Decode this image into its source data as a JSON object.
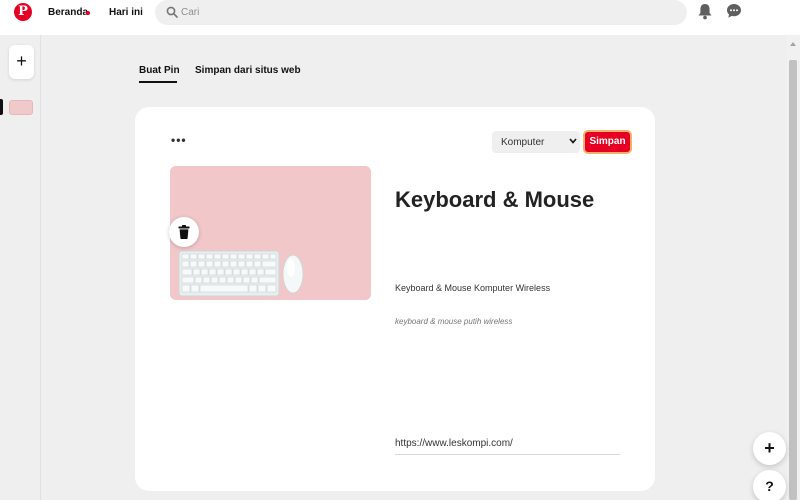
{
  "header": {
    "logo_letter": "P",
    "nav": [
      {
        "label": "Beranda"
      },
      {
        "label": "Hari ini"
      }
    ],
    "search": {
      "placeholder": "Cari"
    }
  },
  "rail": {
    "add_label": "+"
  },
  "tabs": [
    {
      "label": "Buat Pin",
      "active": true
    },
    {
      "label": "Simpan dari situs web",
      "active": false
    }
  ],
  "card": {
    "more_label": "•••",
    "board_select": {
      "selected": "Komputer"
    },
    "save_label": "Simpan",
    "pin": {
      "title": "Keyboard & Mouse",
      "description": "Keyboard & Mouse Komputer Wireless",
      "alt_text": "keyboard & mouse putih wireless",
      "url": "https://www.leskompi.com/"
    }
  },
  "fabs": {
    "add_label": "+",
    "help_label": "?"
  },
  "colors": {
    "brand": "#e60023",
    "save_border": "#f6b26b",
    "pin_background": "#f2c7ca",
    "page_background": "#efefef"
  },
  "icons": [
    "pinterest-logo-icon",
    "search-icon",
    "bell-icon",
    "chat-icon",
    "chevron-down-icon",
    "trash-icon",
    "plus-icon",
    "help-icon"
  ]
}
